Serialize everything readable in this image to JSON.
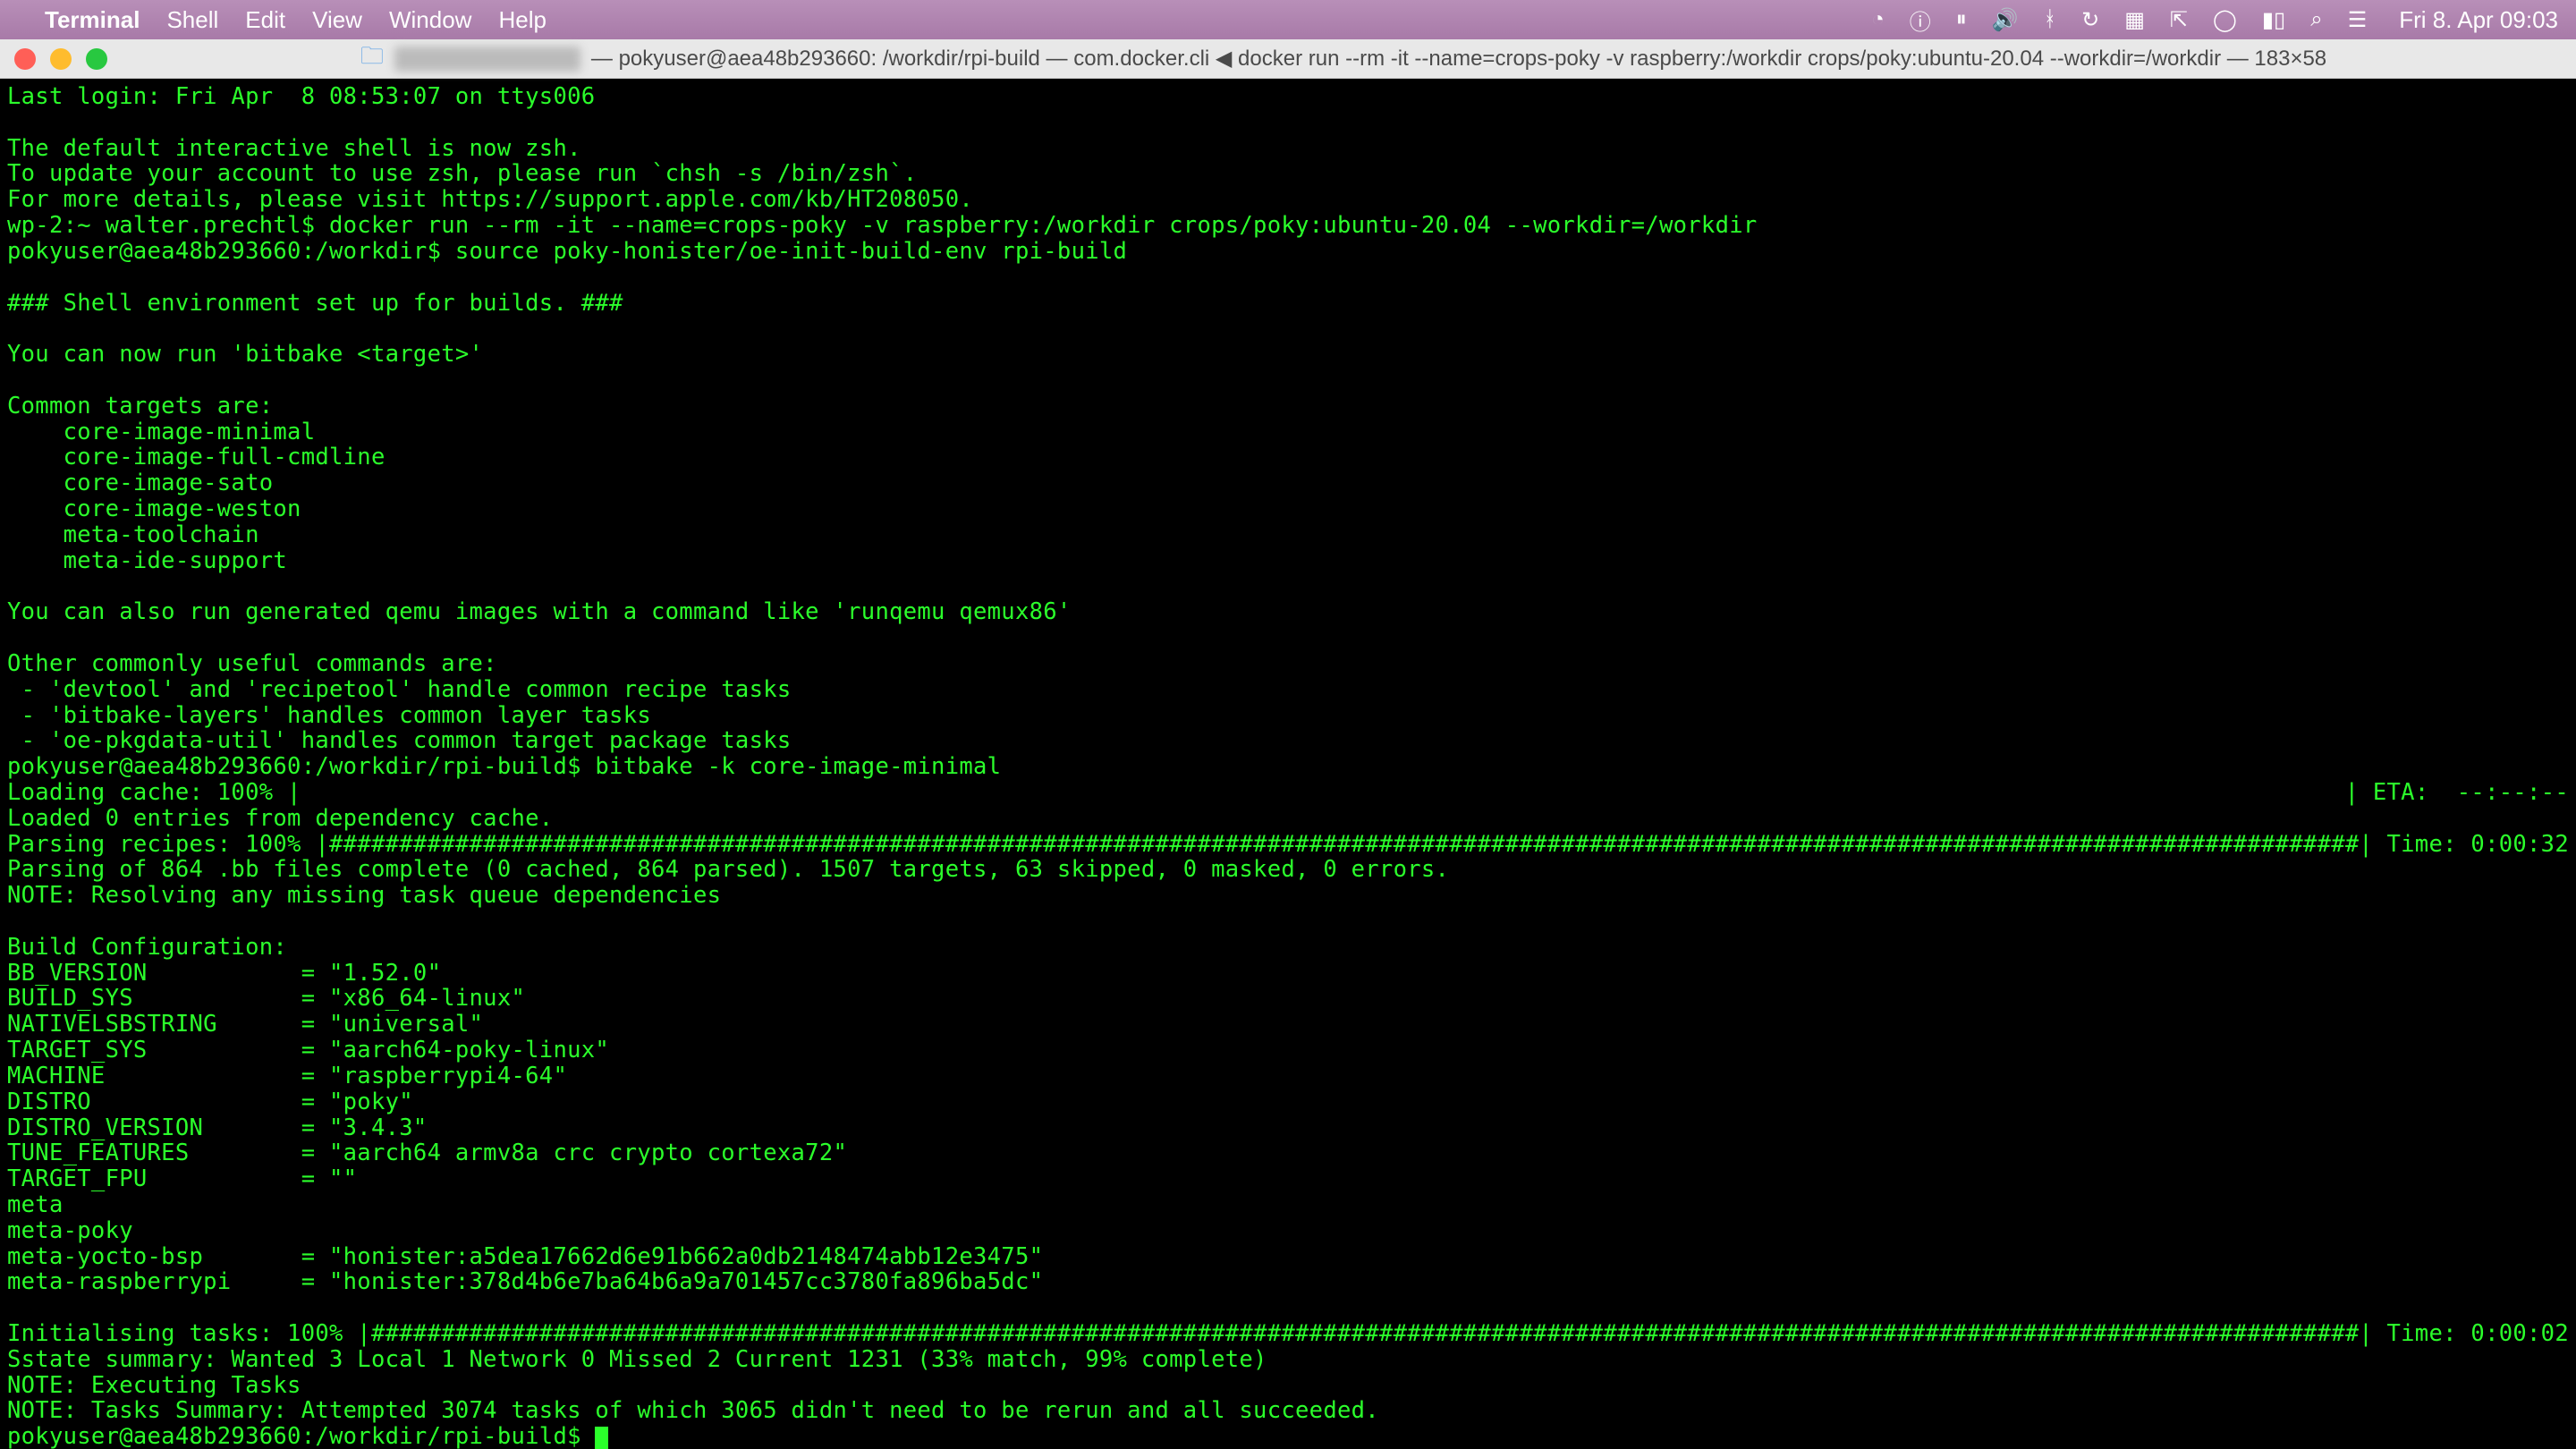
{
  "menubar": {
    "app": "Terminal",
    "items": [
      "Shell",
      "Edit",
      "View",
      "Window",
      "Help"
    ],
    "clock": "Fri 8. Apr  09:03"
  },
  "titlebar": {
    "blurred_user": "XXXXXXXX",
    "title": "— pokyuser@aea48b293660: /workdir/rpi-build — com.docker.cli ◀ docker run --rm -it --name=crops-poky -v raspberry:/workdir crops/poky:ubuntu-20.04 --workdir=/workdir — 183×58"
  },
  "term": {
    "last_login": "Last login: Fri Apr  8 08:53:07 on ttys006",
    "zsh1": "The default interactive shell is now zsh.",
    "zsh2": "To update your account to use zsh, please run `chsh -s /bin/zsh`.",
    "zsh3": "For more details, please visit https://support.apple.com/kb/HT208050.",
    "prompt1": "wp-2:~ walter.prechtl$ docker run --rm -it --name=crops-poky -v raspberry:/workdir crops/poky:ubuntu-20.04 --workdir=/workdir",
    "prompt2": "pokyuser@aea48b293660:/workdir$ source poky-honister/oe-init-build-env rpi-build",
    "env_header": "### Shell environment set up for builds. ###",
    "run_hint": "You can now run 'bitbake <target>'",
    "common_targets_label": "Common targets are:",
    "targets": [
      "    core-image-minimal",
      "    core-image-full-cmdline",
      "    core-image-sato",
      "    core-image-weston",
      "    meta-toolchain",
      "    meta-ide-support"
    ],
    "qemu_hint": "You can also run generated qemu images with a command like 'runqemu qemux86'",
    "other_label": "Other commonly useful commands are:",
    "other_cmds": [
      " - 'devtool' and 'recipetool' handle common recipe tasks",
      " - 'bitbake-layers' handles common layer tasks",
      " - 'oe-pkgdata-util' handles common target package tasks"
    ],
    "prompt3": "pokyuser@aea48b293660:/workdir/rpi-build$ bitbake -k core-image-minimal",
    "cache_left": "Loading cache: 100% |",
    "cache_right": "| ETA:  --:--:--",
    "cache_loaded": "Loaded 0 entries from dependency cache.",
    "parse_left": "Parsing recipes: 100% |",
    "parse_right": "| Time: 0:00:32",
    "parse_summary": "Parsing of 864 .bb files complete (0 cached, 864 parsed). 1507 targets, 63 skipped, 0 masked, 0 errors.",
    "note_resolve": "NOTE: Resolving any missing task queue dependencies",
    "build_conf_header": "Build Configuration:",
    "conf": [
      "BB_VERSION           = \"1.52.0\"",
      "BUILD_SYS            = \"x86_64-linux\"",
      "NATIVELSBSTRING      = \"universal\"",
      "TARGET_SYS           = \"aarch64-poky-linux\"",
      "MACHINE              = \"raspberrypi4-64\"",
      "DISTRO               = \"poky\"",
      "DISTRO_VERSION       = \"3.4.3\"",
      "TUNE_FEATURES        = \"aarch64 armv8a crc crypto cortexa72\"",
      "TARGET_FPU           = \"\"",
      "meta                 ",
      "meta-poky            ",
      "meta-yocto-bsp       = \"honister:a5dea17662d6e91b662a0db2148474abb12e3475\"",
      "meta-raspberrypi     = \"honister:378d4b6e7ba64b6a9a701457cc3780fa896ba5dc\""
    ],
    "init_left": "Initialising tasks: 100% |",
    "init_right": "| Time: 0:00:02",
    "sstate": "Sstate summary: Wanted 3 Local 1 Network 0 Missed 2 Current 1231 (33% match, 99% complete)",
    "note_exec": "NOTE: Executing Tasks",
    "note_summary": "NOTE: Tasks Summary: Attempted 3074 tasks of which 3065 didn't need to be rerun and all succeeded.",
    "prompt4": "pokyuser@aea48b293660:/workdir/rpi-build$ "
  }
}
